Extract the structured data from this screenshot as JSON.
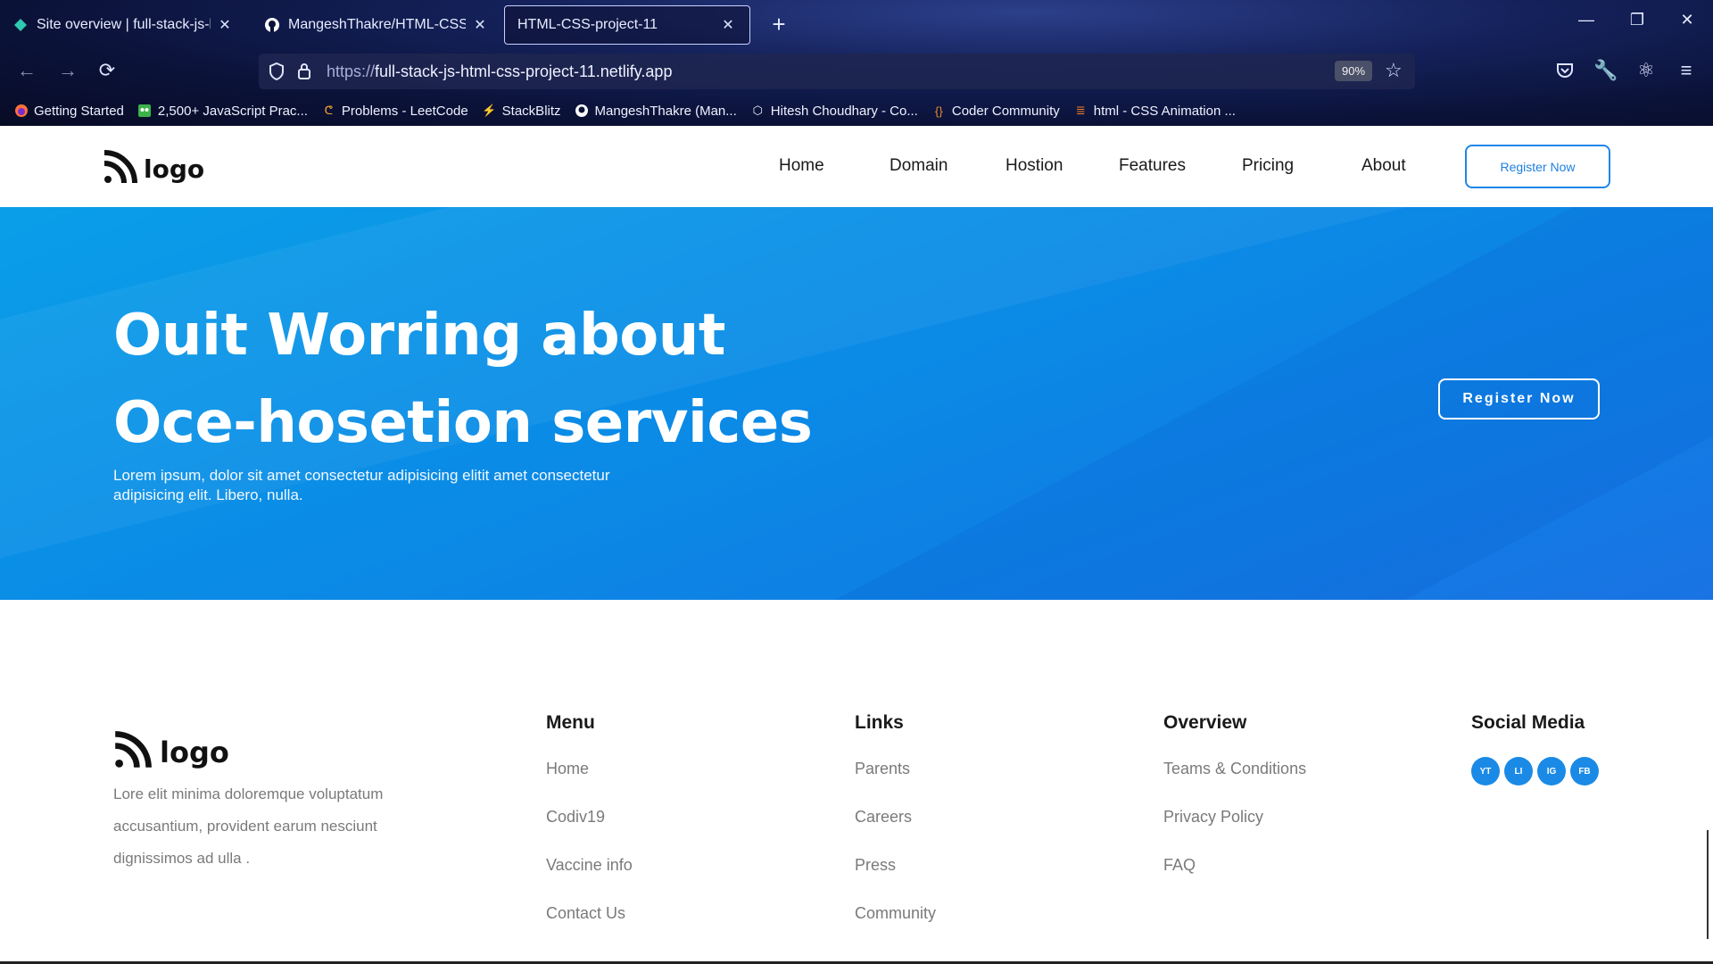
{
  "browser": {
    "tabs": [
      {
        "title": "Site overview | full-stack-js-html-css-project-11",
        "icon": "netlify-icon"
      },
      {
        "title": "MangeshThakre/HTML-CSS-Project-11",
        "icon": "github-icon"
      },
      {
        "title": "HTML-CSS-project-11",
        "icon": "none"
      }
    ],
    "url_proto": "https://",
    "url_host": "full-stack-js-html-css-project-11.netlify.app",
    "zoom": "90%",
    "bookmarks": [
      "Getting Started",
      "2,500+ JavaScript Prac...",
      "Problems - LeetCode",
      "StackBlitz",
      "MangeshThakre (Man...",
      "Hitesh Choudhary - Co...",
      "Coder Community",
      "html - CSS Animation ..."
    ]
  },
  "header": {
    "logo_text": "logo",
    "nav": [
      "Home",
      "Domain",
      "Hostion",
      "Features",
      "Pricing",
      "About"
    ],
    "register_label": "Register Now"
  },
  "hero": {
    "title_line1": "Ouit Worring about",
    "title_line2": "Oce-hosetion services",
    "subtitle": "Lorem ipsum, dolor sit amet consectetur adipisicing elitit amet consectetur adipisicing elit. Libero, nulla.",
    "register_label": "Register Now"
  },
  "footer": {
    "logo_text": "logo",
    "description": "Lore elit minima doloremque voluptatum accusantium, provident earum nesciunt dignissimos ad ulla .",
    "menu": {
      "title": "Menu",
      "links": [
        "Home",
        "Codiv19",
        "Vaccine info",
        "Contact Us"
      ]
    },
    "links": {
      "title": "Links",
      "links": [
        "Parents",
        "Careers",
        "Press",
        "Community"
      ]
    },
    "overview": {
      "title": "Overview",
      "links": [
        "Teams & Conditions",
        "Privacy Policy",
        "FAQ"
      ]
    },
    "social": {
      "title": "Social Media",
      "items": [
        "YT",
        "LI",
        "IG",
        "FB"
      ]
    }
  },
  "colors": {
    "accent": "#1a8ae6",
    "hero_start": "#0a9ee8",
    "hero_end": "#1a73e3"
  }
}
